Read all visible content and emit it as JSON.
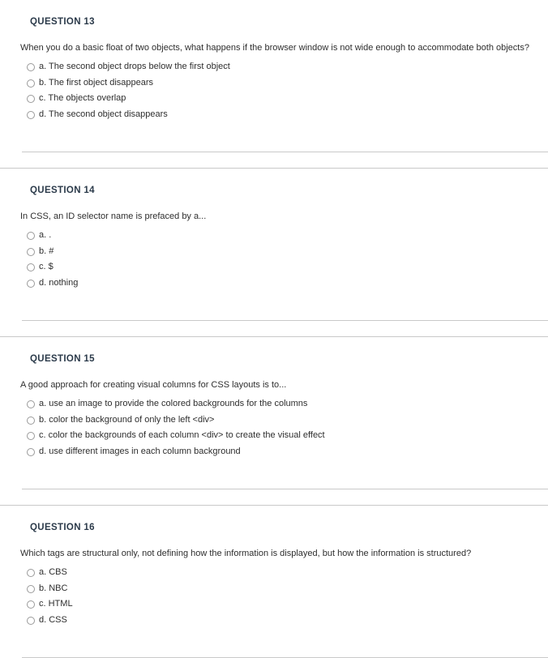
{
  "page": {
    "background_color": "#ffffff",
    "text_color": "#2e2e2e",
    "heading_color": "#2b3a4a",
    "rule_color": "#c9c9c9",
    "radio_border_color": "#9a9a9a"
  },
  "questions": [
    {
      "heading": "QUESTION 13",
      "text": "When you do a basic float of two objects, what happens if the browser window is not wide enough to accommodate both objects?",
      "options": [
        {
          "label": "a. The second object drops below the first object",
          "selected": false
        },
        {
          "label": "b. The first object disappears",
          "selected": false
        },
        {
          "label": "c. The objects overlap",
          "selected": false
        },
        {
          "label": "d. The second object disappears",
          "selected": false
        }
      ]
    },
    {
      "heading": "QUESTION 14",
      "text": "In CSS, an ID selector name is prefaced by a...",
      "options": [
        {
          "label": "a. .",
          "selected": false
        },
        {
          "label": "b. #",
          "selected": false
        },
        {
          "label": "c. $",
          "selected": false
        },
        {
          "label": "d. nothing",
          "selected": false
        }
      ]
    },
    {
      "heading": "QUESTION 15",
      "text": "A good approach for creating visual columns for CSS layouts is to...",
      "options": [
        {
          "label": "a. use an image to provide the colored backgrounds for the columns",
          "selected": false
        },
        {
          "label": "b. color the background of only the left <div>",
          "selected": false
        },
        {
          "label": "c. color the backgrounds of each column <div> to create the visual effect",
          "selected": false
        },
        {
          "label": "d. use different images in each column background",
          "selected": false
        }
      ]
    },
    {
      "heading": "QUESTION 16",
      "text": "Which tags are structural only, not defining how the information is displayed, but how the information is structured?",
      "options": [
        {
          "label": "a. CBS",
          "selected": false
        },
        {
          "label": "b. NBC",
          "selected": false
        },
        {
          "label": "c. HTML",
          "selected": false
        },
        {
          "label": "d. CSS",
          "selected": false
        }
      ]
    }
  ]
}
